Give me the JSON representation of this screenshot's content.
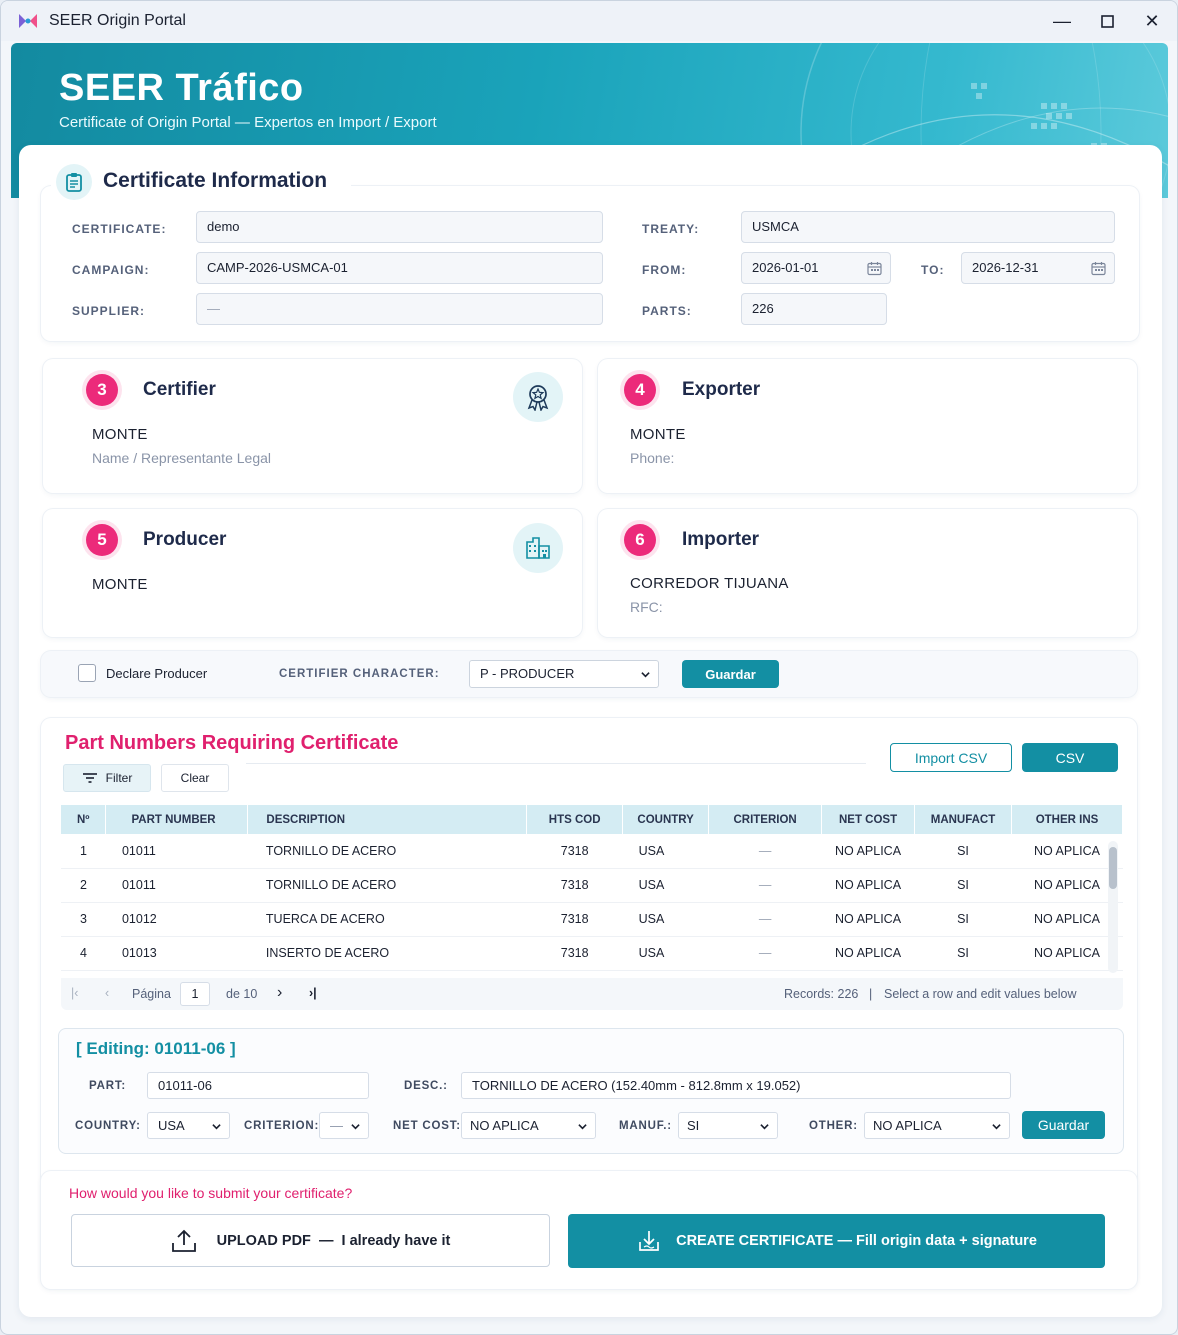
{
  "window": {
    "title": "SEER Origin Portal",
    "minimize": "—",
    "maximize": "☐",
    "close": "✕"
  },
  "hero": {
    "title": "SEER Tráfico",
    "subtitle": "Certificate of Origin Portal — Expertos en Import / Export"
  },
  "cert_info": {
    "title": "Certificate Information",
    "certificate_label": "CERTIFICATE:",
    "certificate_value": "demo",
    "campaign_label": "CAMPAIGN:",
    "campaign_value": "CAMP-2026-USMCA-01",
    "supplier_label": "SUPPLIER:",
    "supplier_value": "—",
    "treaty_label": "TREATY:",
    "treaty_value": "USMCA",
    "from_label": "FROM:",
    "from_value": "2026-01-01",
    "to_label": "TO:",
    "to_value": "2026-12-31",
    "parts_label": "PARTS:",
    "parts_value": "226"
  },
  "parties": {
    "certifier": {
      "num": "3",
      "title": "Certifier",
      "name": "MONTE",
      "sub": "Name / Representante Legal"
    },
    "exporter": {
      "num": "4",
      "title": "Exporter",
      "name": "MONTE",
      "sub": "Phone:"
    },
    "producer": {
      "num": "5",
      "title": "Producer",
      "name": "MONTE"
    },
    "importer": {
      "num": "6",
      "title": "Importer",
      "name": "CORREDOR TIJUANA",
      "sub": "RFC:"
    }
  },
  "declare": {
    "checkbox_label": "Declare Producer",
    "character_label": "CERTIFIER CHARACTER:",
    "character_value": "P - PRODUCER",
    "save": "Guardar"
  },
  "parts": {
    "title": "Part Numbers Requiring Certificate",
    "filter": "Filter",
    "clear": "Clear",
    "import_csv": "Import CSV",
    "csv": "CSV",
    "columns": [
      "Nº",
      "PART NUMBER",
      "DESCRIPTION",
      "HTS COD",
      "COUNTRY",
      "CRITERION",
      "NET COST",
      "MANUFACT",
      "OTHER INS"
    ],
    "rows": [
      [
        "1",
        "01011",
        "TORNILLO DE ACERO",
        "7318",
        "USA",
        "—",
        "NO APLICA",
        "SI",
        "NO APLICA"
      ],
      [
        "2",
        "01011",
        "TORNILLO DE ACERO",
        "7318",
        "USA",
        "—",
        "NO APLICA",
        "SI",
        "NO APLICA"
      ],
      [
        "3",
        "01012",
        "TUERCA DE ACERO",
        "7318",
        "USA",
        "—",
        "NO APLICA",
        "SI",
        "NO APLICA"
      ],
      [
        "4",
        "01013",
        "INSERTO DE ACERO",
        "7318",
        "USA",
        "—",
        "NO APLICA",
        "SI",
        "NO APLICA"
      ]
    ],
    "pager": {
      "page_label": "Página",
      "page": "1",
      "of": "de 10",
      "records": "Records: 226",
      "sep": "|",
      "hint": "Select a row and edit values below"
    }
  },
  "editing": {
    "title": "[ Editing: 01011-06 ]",
    "part_label": "PART:",
    "part_value": "01011-06",
    "desc_label": "DESC.:",
    "desc_value": "TORNILLO DE ACERO (152.40mm - 812.8mm x 19.052)",
    "country_label": "COUNTRY:",
    "country_value": "USA",
    "criterion_label": "CRITERION:",
    "criterion_value": "—",
    "netcost_label": "NET COST:",
    "netcost_value": "NO APLICA",
    "manuf_label": "MANUF.:",
    "manuf_value": "SI",
    "other_label": "OTHER:",
    "other_value": "NO APLICA",
    "save": "Guardar"
  },
  "submit": {
    "question": "How would you like to submit your certificate?",
    "upload": "UPLOAD PDF  —  I already have it",
    "create": "CREATE CERTIFICATE — Fill origin data + signature"
  },
  "colors": {
    "teal": "#138fa3",
    "pink": "#ec2a7a",
    "navy": "#1e2a4a"
  }
}
